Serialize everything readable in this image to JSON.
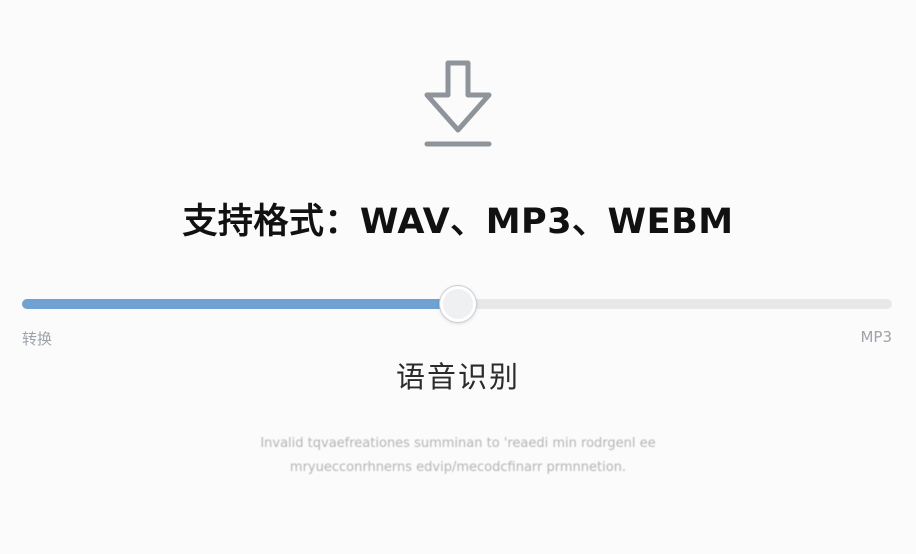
{
  "icon": {
    "name": "download-icon",
    "color": "#8e9499"
  },
  "formats_text": "支持格式：WAV、MP3、WEBM",
  "slider": {
    "value_fraction": 0.5,
    "min_label": "转换",
    "max_label": "MP3",
    "track_color": "#e7e8ea",
    "fill_color": "#6fa2d2"
  },
  "mode_label": "语音识别",
  "description": {
    "line1": "Invalid tqvaefreationes summinan to 'reaedi min rodrgenl ee",
    "line2": "mryuecconrhnerns edvip/mecodcfinarr prmnnetion."
  }
}
